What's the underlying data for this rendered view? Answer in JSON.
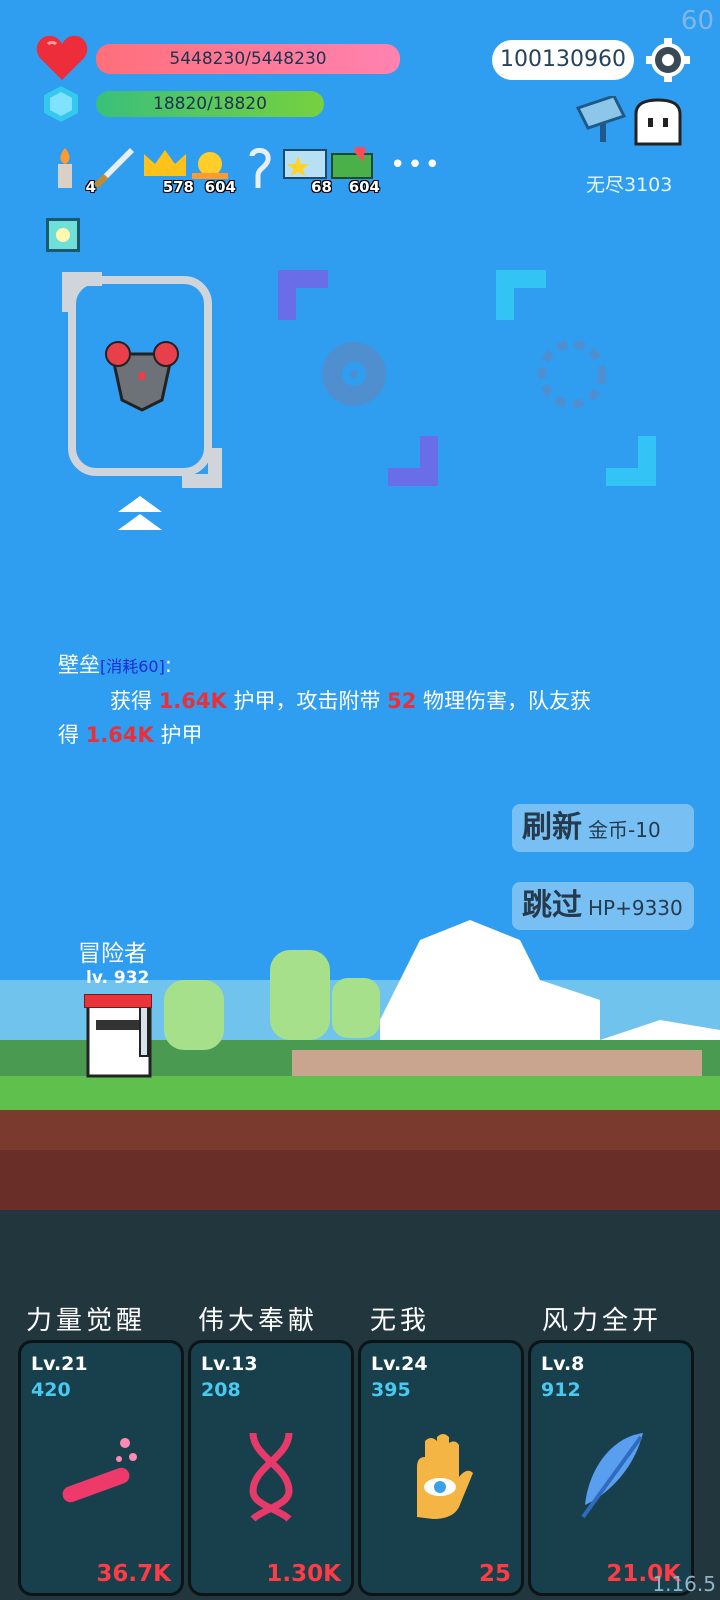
{
  "fps": "60",
  "version": "1.16.5",
  "stats": {
    "hp": "5448230/5448230",
    "mp": "18820/18820",
    "gold": "100130960"
  },
  "mode": {
    "label": "无尽3103"
  },
  "inventory": [
    {
      "icon": "candle-icon",
      "count": "4"
    },
    {
      "icon": "sword-icon",
      "count": ""
    },
    {
      "icon": "crown-icon",
      "count": "578"
    },
    {
      "icon": "sun-icon",
      "count": "604"
    },
    {
      "icon": "hook-icon",
      "count": ""
    },
    {
      "icon": "star-card-icon",
      "count": "68"
    },
    {
      "icon": "heart-card-icon",
      "count": "604"
    }
  ],
  "more_label": "•••",
  "skill_choice": {
    "name": "壁垒",
    "cost": "[消耗60]",
    "colon": ":",
    "line1_a": "获得 ",
    "line1_v1": "1.64K",
    "line1_b": " 护甲，攻击附带 ",
    "line1_v2": "52",
    "line1_c": " 物理伤害，队友获",
    "line2_a": "得 ",
    "line2_v": "1.64K",
    "line2_b": " 护甲"
  },
  "buttons": {
    "refresh_label": "刷新",
    "refresh_cost": "金币-10",
    "skip_label": "跳过",
    "skip_gain": "HP+9330"
  },
  "hero": {
    "name": "冒险者",
    "level": "lv. 932"
  },
  "skills": [
    {
      "title": "力量觉醒",
      "level": "Lv.21",
      "value": "420",
      "cost": "36.7K",
      "icon": "potion-icon"
    },
    {
      "title": "伟大奉献",
      "level": "Lv.13",
      "value": "208",
      "cost": "1.30K",
      "icon": "dna-icon"
    },
    {
      "title": "无我",
      "level": "Lv.24",
      "value": "395",
      "cost": "25",
      "icon": "eye-hand-icon"
    },
    {
      "title": "风力全开",
      "level": "Lv.8",
      "value": "912",
      "cost": "21.0K",
      "icon": "feather-icon"
    }
  ],
  "colors": {
    "sky": "#2f9df0",
    "hp": "#ff6f7b",
    "mp": "#4cc36a",
    "highlight": "#e8303a",
    "cost": "#ff3b46"
  }
}
